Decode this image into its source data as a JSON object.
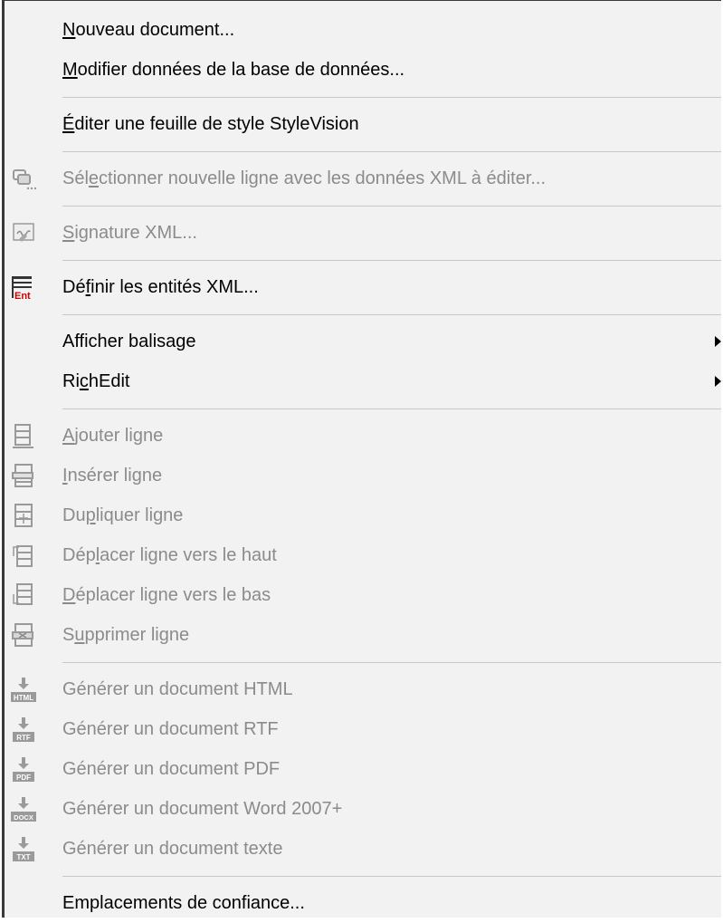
{
  "menu": {
    "items": [
      {
        "pre": "",
        "u": "N",
        "post": "ouveau document...",
        "disabled": false
      },
      {
        "pre": "",
        "u": "M",
        "post": "odifier données de la base de données...",
        "disabled": false
      },
      {
        "pre": "",
        "u": "É",
        "post": "diter une feuille de style StyleVision",
        "disabled": false
      },
      {
        "pre": "Sél",
        "u": "e",
        "post": "ctionner nouvelle ligne avec les données XML à éditer...",
        "disabled": true,
        "icon": "select-row-icon"
      },
      {
        "pre": "",
        "u": "S",
        "post": "ignature XML...",
        "disabled": true,
        "icon": "signature-icon"
      },
      {
        "pre": "Dé",
        "u": "f",
        "post": "inir les entités XML...",
        "disabled": false,
        "icon": "entities-icon"
      },
      {
        "pre": "Afficher balisage",
        "u": "",
        "post": "",
        "disabled": false,
        "submenu": true
      },
      {
        "pre": "Ri",
        "u": "c",
        "post": "hEdit",
        "disabled": false,
        "submenu": true
      },
      {
        "pre": "",
        "u": "A",
        "post": "jouter ligne",
        "disabled": true,
        "icon": "append-row-icon"
      },
      {
        "pre": "",
        "u": "I",
        "post": "nsérer ligne",
        "disabled": true,
        "icon": "insert-row-icon"
      },
      {
        "pre": "Du",
        "u": "p",
        "post": "liquer ligne",
        "disabled": true,
        "icon": "duplicate-row-icon"
      },
      {
        "pre": "Dép",
        "u": "l",
        "post": "acer ligne vers le haut",
        "disabled": true,
        "icon": "move-row-up-icon"
      },
      {
        "pre": "",
        "u": "D",
        "post": "éplacer ligne vers le bas",
        "disabled": true,
        "icon": "move-row-down-icon"
      },
      {
        "pre": "S",
        "u": "u",
        "post": "pprimer ligne",
        "disabled": true,
        "icon": "delete-row-icon"
      },
      {
        "pre": "Générer un document HTML",
        "u": "",
        "post": "",
        "disabled": true,
        "icon": "html-icon",
        "iconText": "HTML"
      },
      {
        "pre": "Générer un document RTF",
        "u": "",
        "post": "",
        "disabled": true,
        "icon": "rtf-icon",
        "iconText": "RTF"
      },
      {
        "pre": "Générer un document PDF",
        "u": "",
        "post": "",
        "disabled": true,
        "icon": "pdf-icon",
        "iconText": "PDF"
      },
      {
        "pre": "Générer un document Word 2007+",
        "u": "",
        "post": "",
        "disabled": true,
        "icon": "docx-icon",
        "iconText": "DOCX"
      },
      {
        "pre": "Générer un document texte",
        "u": "",
        "post": "",
        "disabled": true,
        "icon": "txt-icon",
        "iconText": "TXT"
      },
      {
        "pre": "Emplacements de confiance...",
        "u": "",
        "post": "",
        "disabled": false
      }
    ],
    "entities_icon_text": "Ent"
  }
}
